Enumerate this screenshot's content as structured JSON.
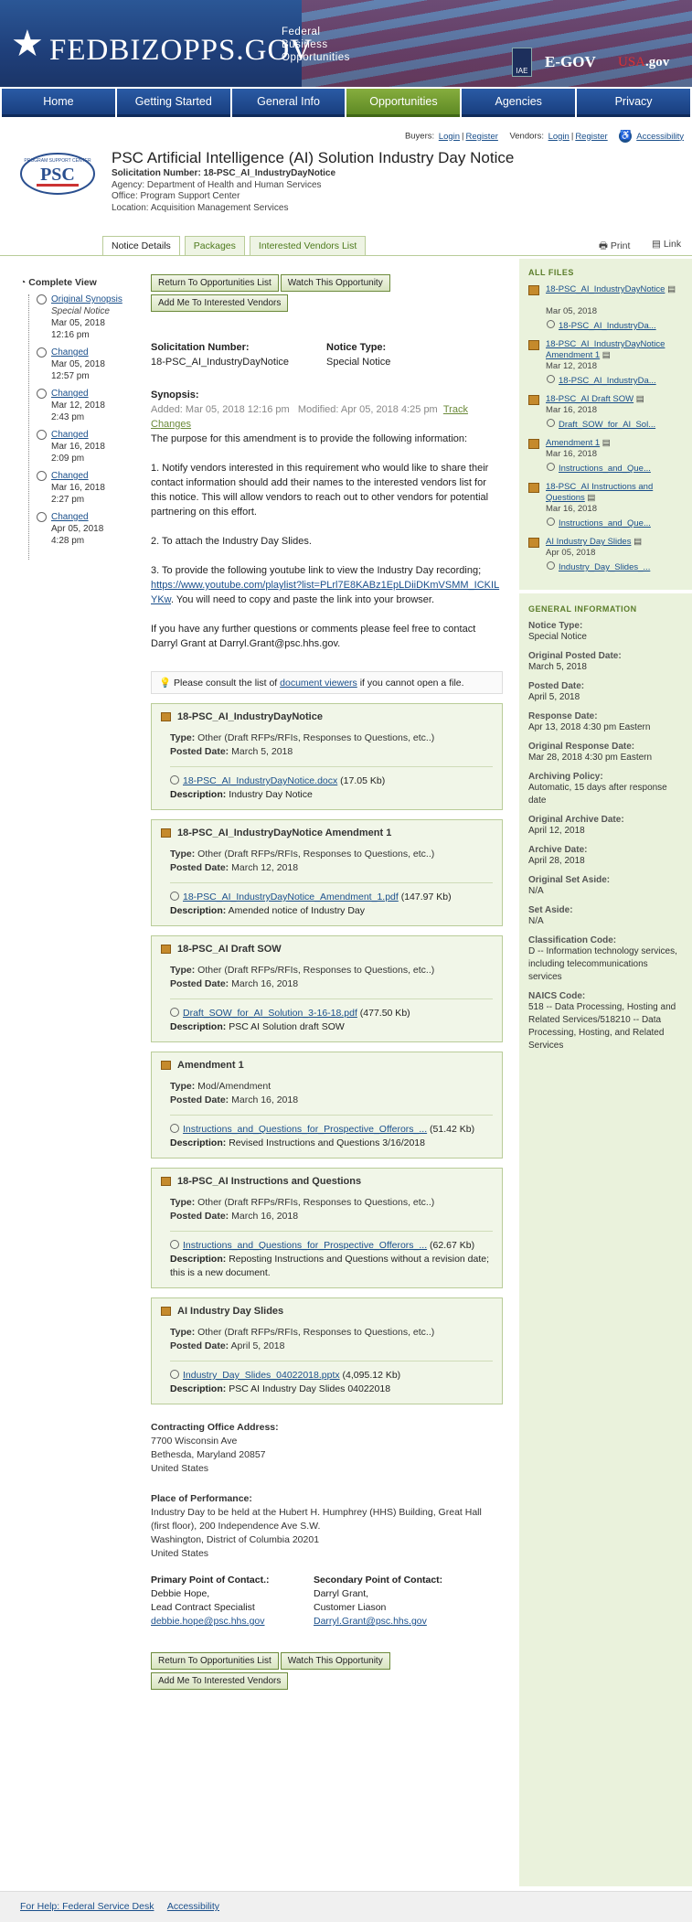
{
  "banner": {
    "logo_text": "FEDBIZOPPS.GOV",
    "sub": [
      "Federal",
      "Business",
      "Opportunities"
    ],
    "iae": "IAE",
    "egov": "E-GOV",
    "usagov_a": "USA",
    "usagov_b": ".gov"
  },
  "nav": [
    "Home",
    "Getting Started",
    "General Info",
    "Opportunities",
    "Agencies",
    "Privacy"
  ],
  "account": {
    "buyers": "Buyers:",
    "login": "Login",
    "register": "Register",
    "vendors": "Vendors:",
    "accessibility": "Accessibility",
    "sep": "|"
  },
  "header": {
    "logo_text": "PSC",
    "logo_sub": "PROGRAM SUPPORT CENTER",
    "title": "PSC Artificial Intelligence (AI) Solution Industry Day Notice",
    "solicitation": "Solicitation Number: 18-PSC_AI_IndustryDayNotice",
    "agency": "Agency: Department of Health and Human Services",
    "office": "Office: Program Support Center",
    "location": "Location: Acquisition Management Services"
  },
  "tabs": [
    "Notice Details",
    "Packages",
    "Interested Vendors List"
  ],
  "print": "Print",
  "link": "Link",
  "left": {
    "title": "Complete View",
    "items": [
      {
        "label": "Original Synopsis",
        "sub": "Special Notice",
        "date": "Mar 05, 2018",
        "time": "12:16 pm"
      },
      {
        "label": "Changed",
        "date": "Mar 05, 2018",
        "time": "12:57 pm"
      },
      {
        "label": "Changed",
        "date": "Mar 12, 2018",
        "time": "2:43 pm"
      },
      {
        "label": "Changed",
        "date": "Mar 16, 2018",
        "time": "2:09 pm"
      },
      {
        "label": "Changed",
        "date": "Mar 16, 2018",
        "time": "2:27 pm"
      },
      {
        "label": "Changed",
        "date": "Apr 05, 2018",
        "time": "4:28 pm"
      }
    ]
  },
  "buttons": {
    "return": "Return To Opportunities List",
    "watch": "Watch This Opportunity",
    "add": "Add Me To Interested Vendors"
  },
  "main": {
    "sol_label": "Solicitation Number:",
    "sol_value": "18-PSC_AI_IndustryDayNotice",
    "type_label": "Notice Type:",
    "type_value": "Special Notice",
    "synopsis_label": "Synopsis:",
    "added": "Added: Mar 05, 2018 12:16 pm",
    "modified": "Modified: Apr 05, 2018 4:25 pm",
    "track": "Track Changes",
    "p1": "The purpose for this amendment is to provide the following information:",
    "p2": "1. Notify vendors interested in this requirement who would like to share their contact information should add their names to the interested vendors list for this notice.  This will allow vendors to reach out to other vendors for potential partnering on this effort.",
    "p3": "2. To attach the Industry Day Slides.",
    "p4a": "3. To provide the following youtube link to view the Industry Day recording;",
    "p4link": "https://www.youtube.com/playlist?list=PLrl7E8KABz1EpLDiiDKmVSMM_ICKILYKw",
    "p4b": ".  You will need to copy and paste the link into your browser.",
    "p5": "If you have any further questions or comments please feel free to contact Darryl Grant at Darryl.Grant@psc.hhs.gov.",
    "consult_a": "Please consult the list of ",
    "consult_link": "document viewers",
    "consult_b": " if you cannot open a file."
  },
  "docs": [
    {
      "title": "18-PSC_AI_IndustryDayNotice",
      "type": "Other (Draft RFPs/RFIs, Responses to Questions, etc..)",
      "posted": "March 5, 2018",
      "file": "18-PSC_AI_IndustryDayNotice.docx",
      "size": "(17.05 Kb)",
      "desc": "Industry Day Notice"
    },
    {
      "title": "18-PSC_AI_IndustryDayNotice Amendment 1",
      "type": "Other (Draft RFPs/RFIs, Responses to Questions, etc..)",
      "posted": "March 12, 2018",
      "file": "18-PSC_AI_IndustryDayNotice_Amendment_1.pdf",
      "size": "(147.97 Kb)",
      "desc": "Amended notice of Industry Day"
    },
    {
      "title": "18-PSC_AI Draft SOW",
      "type": "Other (Draft RFPs/RFIs, Responses to Questions, etc..)",
      "posted": "March 16, 2018",
      "file": "Draft_SOW_for_AI_Solution_3-16-18.pdf",
      "size": "(477.50 Kb)",
      "desc": "PSC AI Solution draft SOW"
    },
    {
      "title": "Amendment 1",
      "type": "Mod/Amendment",
      "posted": "March 16, 2018",
      "file": "Instructions_and_Questions_for_Prospective_Offerors_...",
      "size": "(51.42 Kb)",
      "desc": "Revised Instructions and Questions 3/16/2018"
    },
    {
      "title": "18-PSC_AI Instructions and Questions",
      "type": "Other (Draft RFPs/RFIs, Responses to Questions, etc..)",
      "posted": "March 16, 2018",
      "file": "Instructions_and_Questions_for_Prospective_Offerors_...",
      "size": "(62.67 Kb)",
      "desc": "Reposting Instructions and Questions without a revision date; this is a new document."
    },
    {
      "title": "AI Industry Day Slides",
      "type": "Other (Draft RFPs/RFIs, Responses to Questions, etc..)",
      "posted": "April 5, 2018",
      "file": "Industry_Day_Slides_04022018.pptx",
      "size": "(4,095.12 Kb)",
      "desc": "PSC AI Industry Day Slides 04022018"
    }
  ],
  "doc_labels": {
    "type": "Type:",
    "posted": "Posted Date:",
    "desc": "Description:"
  },
  "contracting": {
    "label": "Contracting Office Address:",
    "lines": [
      "7700 Wisconsin Ave",
      "Bethesda, Maryland 20857",
      "United States"
    ]
  },
  "performance": {
    "label": "Place of Performance:",
    "lines": [
      "Industry Day to be held at the Hubert H. Humphrey (HHS) Building, Great Hall (first floor), 200 Independence Ave S.W.",
      "Washington, District of Columbia 20201",
      "United States"
    ]
  },
  "contacts": {
    "primary": {
      "label": "Primary Point of Contact.:",
      "name": "Debbie Hope,",
      "title": "Lead Contract Specialist",
      "email": "debbie.hope@psc.hhs.gov"
    },
    "secondary": {
      "label": "Secondary Point of Contact:",
      "name": "Darryl Grant,",
      "title": "Customer Liason",
      "email": "Darryl.Grant@psc.hhs.gov"
    }
  },
  "allfiles": {
    "head": "ALL FILES",
    "items": [
      {
        "title": "18-PSC_AI_IndustryDayNotice",
        "date": "Mar 05, 2018",
        "sub": "18-PSC_AI_IndustryDa..."
      },
      {
        "title": "18-PSC_AI_IndustryDayNotice Amendment 1",
        "date": "Mar 12, 2018",
        "sub": "18-PSC_AI_IndustryDa..."
      },
      {
        "title": "18-PSC_AI Draft SOW",
        "date": "Mar 16, 2018",
        "sub": "Draft_SOW_for_AI_Sol..."
      },
      {
        "title": "Amendment 1",
        "date": "Mar 16, 2018",
        "sub": "Instructions_and_Que..."
      },
      {
        "title": "18-PSC_AI Instructions and Questions",
        "date": "Mar 16, 2018",
        "sub": "Instructions_and_Que..."
      },
      {
        "title": "AI Industry Day Slides",
        "date": "Apr 05, 2018",
        "sub": "Industry_Day_Slides_..."
      }
    ]
  },
  "geninfo": {
    "head": "GENERAL INFORMATION",
    "fields": [
      {
        "label": "Notice Type:",
        "value": "Special Notice"
      },
      {
        "label": "Original Posted Date:",
        "value": "March 5, 2018"
      },
      {
        "label": "Posted Date:",
        "value": "April 5, 2018"
      },
      {
        "label": "Response Date:",
        "value": "Apr 13, 2018 4:30 pm Eastern"
      },
      {
        "label": "Original Response Date:",
        "value": "Mar 28, 2018 4:30 pm Eastern"
      },
      {
        "label": "Archiving Policy:",
        "value": "Automatic, 15 days after response date"
      },
      {
        "label": "Original Archive Date:",
        "value": "April 12, 2018"
      },
      {
        "label": "Archive Date:",
        "value": "April 28, 2018"
      },
      {
        "label": "Original Set Aside:",
        "value": "N/A"
      },
      {
        "label": "Set Aside:",
        "value": "N/A"
      },
      {
        "label": "Classification Code:",
        "value": "D -- Information technology services, including telecommunications services"
      },
      {
        "label": "NAICS Code:",
        "value": "518 -- Data Processing, Hosting and Related Services/518210 -- Data Processing, Hosting, and Related Services"
      }
    ]
  },
  "footer": {
    "help": "For Help: Federal Service Desk",
    "accessibility": "Accessibility"
  }
}
